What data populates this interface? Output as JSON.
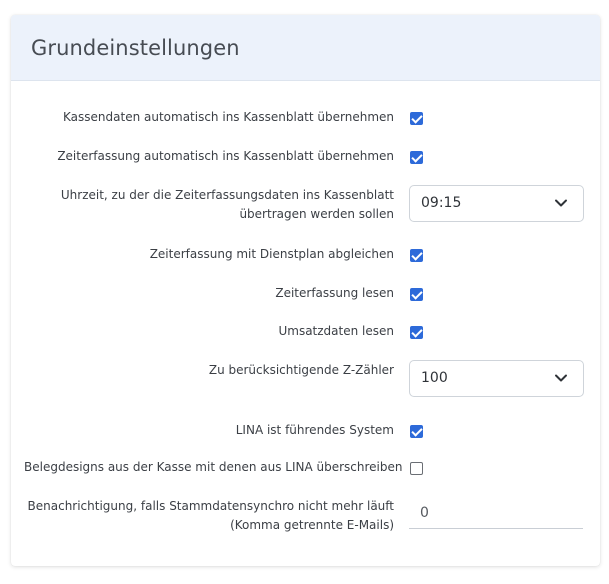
{
  "card": {
    "title": "Grundeinstellungen"
  },
  "settings": {
    "kassendaten": {
      "label": "Kassendaten automatisch ins Kassenblatt übernehmen",
      "checked": true
    },
    "zeiterfassung_auto": {
      "label": "Zeiterfassung automatisch ins Kassenblatt übernehmen",
      "checked": true
    },
    "uhrzeit": {
      "label_line1": "Uhrzeit, zu der die Zeiterfassungsdaten ins Kassenblatt",
      "label_line2": "übertragen werden sollen",
      "value": "09:15",
      "icon": "chevron-down-icon"
    },
    "dienstplan": {
      "label": "Zeiterfassung mit Dienstplan abgleichen",
      "checked": true
    },
    "zeiterfassung_lesen": {
      "label": "Zeiterfassung lesen",
      "checked": true
    },
    "umsatzdaten": {
      "label": "Umsatzdaten lesen",
      "checked": true
    },
    "z_zaehler": {
      "label": "Zu berücksichtigende Z-Zähler",
      "value": "100",
      "icon": "chevron-down-icon"
    },
    "lina_fuehrend": {
      "label": "LINA ist führendes System",
      "checked": true
    },
    "belegdesigns": {
      "label": "Belegdesigns aus der Kasse mit denen aus LINA überschreiben",
      "checked": false
    },
    "benachrichtigung": {
      "label_line1": "Benachrichtigung, falls Stammdatensynchro nicht mehr läuft",
      "label_line2": "(Komma getrennte E-Mails)",
      "value": "0"
    }
  },
  "colors": {
    "accent": "#2d6ad9",
    "header_bg": "#ecf2fb"
  }
}
